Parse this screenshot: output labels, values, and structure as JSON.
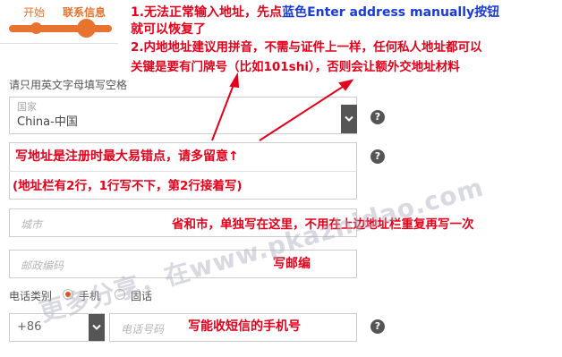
{
  "progress": {
    "step1": "开始",
    "step2": "联系信息"
  },
  "annotations": {
    "line1_prefix": "1.无法正常输入地址，先点",
    "line1_blue": "蓝色",
    "line1_suffix": "Enter address manually按钮",
    "line2": "就可以恢复了",
    "line3": "2.内地地址建议用拼音，不需与证件上一样，任何私人地址都可以",
    "line4": "关键是要有门牌号（比如101shi），否则会让额外交地址材料",
    "address_tip": "写地址是注册时最大易错点，请多留意↑",
    "address_lines_tip": "(地址栏有2行，1行写不下，第2行接着写)",
    "city_tip": "省和市，单独写在这里，不用在上边地址栏重复再写一次",
    "postal_tip": "写邮编",
    "phone_tip": "写能收短信的手机号"
  },
  "form": {
    "instruction": "请只用英文字母填写空格",
    "country_label": "国家",
    "country_value": "China-中国",
    "city_placeholder": "城市",
    "postal_placeholder": "邮政编码",
    "phone_type_label": "电话类别",
    "phone_type_options": [
      "手机",
      "固话"
    ],
    "phone_type_selected": "手机",
    "country_code": "+86",
    "phone_placeholder": "电话号码",
    "help_symbol": "?"
  },
  "watermark": "更多分享，在www.pkazhidao.com",
  "colors": {
    "accent": "#e8732e",
    "annotation_red": "#e4001b",
    "annotation_blue": "#1a3bd4"
  }
}
